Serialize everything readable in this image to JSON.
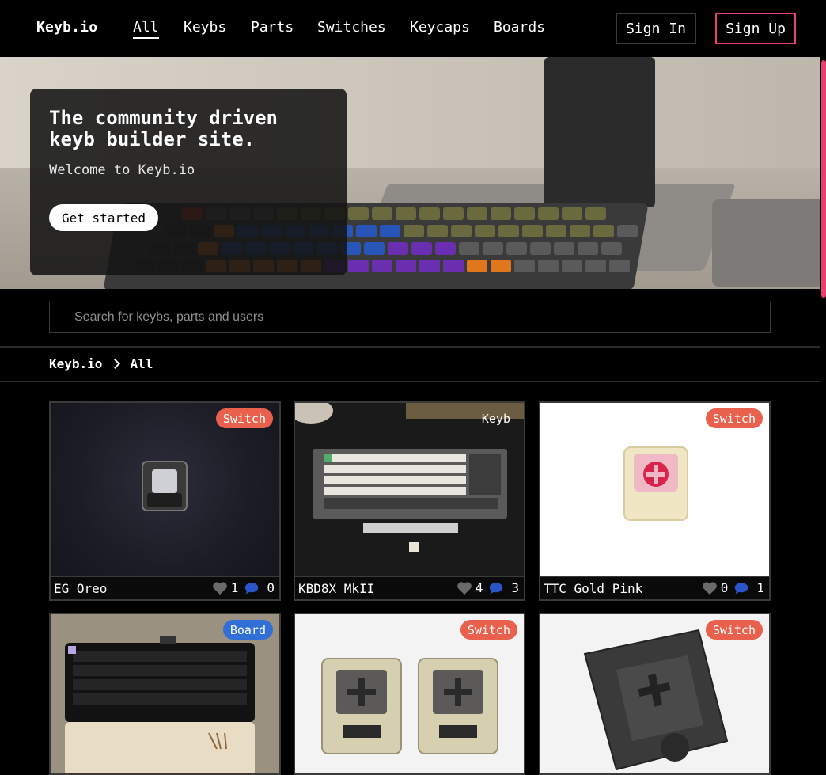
{
  "nav": {
    "brand": "Keyb.io",
    "links": [
      "All",
      "Keybs",
      "Parts",
      "Switches",
      "Keycaps",
      "Boards"
    ],
    "sign_in": "Sign In",
    "sign_up": "Sign Up"
  },
  "hero": {
    "title": "The community driven keyb builder site.",
    "subtitle": "Welcome to Keyb.io",
    "cta": "Get started"
  },
  "search": {
    "placeholder": "Search for keybs, parts and users"
  },
  "breadcrumb": {
    "root": "Keyb.io",
    "current": "All"
  },
  "cards": [
    {
      "name": "EG Oreo",
      "tag": "Switch",
      "likes": "1",
      "comments": "0"
    },
    {
      "name": "KBD8X MkII",
      "tag": "Keyb",
      "likes": "4",
      "comments": "3"
    },
    {
      "name": "TTC Gold Pink",
      "tag": "Switch",
      "likes": "0",
      "comments": "1"
    },
    {
      "name": "",
      "tag": "Board",
      "likes": "",
      "comments": ""
    },
    {
      "name": "",
      "tag": "Switch",
      "likes": "",
      "comments": ""
    },
    {
      "name": "",
      "tag": "Switch",
      "likes": "",
      "comments": ""
    }
  ],
  "colors": {
    "accent": "#e8416f",
    "switch_badge": "#e9614d",
    "board_badge": "#2f6fd6",
    "comment_icon": "#2a55c8"
  }
}
